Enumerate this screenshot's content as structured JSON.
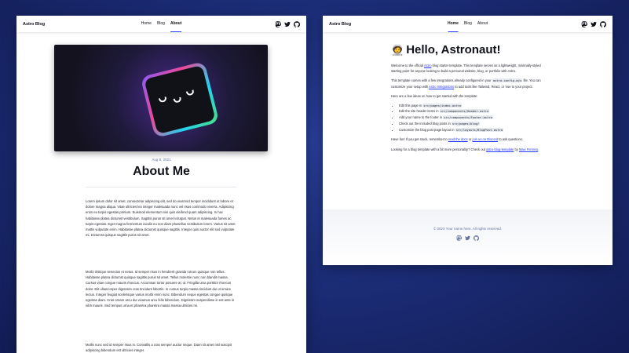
{
  "left": {
    "brand": "Astro Blog",
    "nav": [
      "Home",
      "Blog",
      "About"
    ],
    "active_nav": "About",
    "date": "Aug 8, 2021",
    "title": "About Me",
    "p1": "Lorem ipsum dolor sit amet, consectetur adipiscing elit, sed do eiusmod tempor incididunt ut labore et dolore magna aliqua. Vitae ultricies leo integer malesuada nunc vel risus commodo viverra. Adipiscing enim eu turpis egestas pretium. Euismod elementum nisi quis eleifend quam adipiscing. In hac habitasse platea dictumst vestibulum. Sagittis purus sit amet volutpat. Netus et malesuada fames ac turpis egestas. Eget magna fermentum iaculis eu non diam phasellus vestibulum lorem. Varius sit amet mattis vulputate enim. Habitasse platea dictumst quisque sagittis. Integer quis auctor elit sed vulputate mi. Dictumst quisque sagittis purus sit amet.",
    "p2": "Morbi tristique senectus et netus. Id semper risus in hendrerit gravida rutrum quisque non tellus. Habitasse platea dictumst quisque sagittis purus sit amet. Tellus molestie nunc non blandit massa. Cursus vitae congue mauris rhoncus. Accumsan tortor posuere ac ut. Fringilla urna porttitor rhoncus dolor. Elit ullamcorper dignissim cras tincidunt lobortis. In cursus turpis massa tincidunt dui ut ornare lectus. Integer feugiat scelerisque varius morbi enim nunc. Bibendum neque egestas congue quisque egestas diam. Cras ornare arcu dui vivamus arcu felis bibendum. Dignissim suspendisse in est ante in nibh mauris. Sed tempus urna et pharetra pharetra massa massa ultricies mi.",
    "p3": "Mollis nunc sed id semper risus in. Convallis a cras semper auctor neque. Diam sit amet nisl suscipit adipiscing bibendum est ultricies integer."
  },
  "right": {
    "brand": "Astro Blog",
    "nav": [
      "Home",
      "Blog",
      "About"
    ],
    "active_nav": "Home",
    "emoji": "🧑‍🚀",
    "heading": "Hello, Astronaut!",
    "intro_before": "Welcome to the official ",
    "intro_link": "Astro",
    "intro_after": " blog starter template. This template serves as a lightweight, minimally-styled starting point for anyone looking to build a personal website, blog, or portfolio with Astro.",
    "integrations_a": "This template comes with a few integrations already configured in your ",
    "integrations_code": "astro.config.mjs",
    "integrations_b": " file. You can customize your setup with ",
    "integrations_link": "Astro Integrations",
    "integrations_c": " to add tools like Tailwind, React, or Vue to your project.",
    "ideas_intro": "Here are a few ideas on how to get started with the template:",
    "ideas": [
      {
        "text": "Edit this page in ",
        "code": "src/pages/index.astro"
      },
      {
        "text": "Edit the site header items in ",
        "code": "src/components/Header.astro"
      },
      {
        "text": "Add your name to the footer in ",
        "code": "src/components/Footer.astro"
      },
      {
        "text": "Check out the included blog posts in ",
        "code": "src/pages/blog/"
      },
      {
        "text": "Customize the blog post page layout in ",
        "code": "src/layouts/BlogPost.astro"
      }
    ],
    "fun_a": "Have fun! If you get stuck, remember to ",
    "fun_link1": "read the docs",
    "fun_b": " or ",
    "fun_link2": "join us on Discord",
    "fun_c": " to ask questions.",
    "more_a": "Looking for a blog template with a bit more personality? Check out ",
    "more_link1": "astro-blog-template",
    "more_b": " by ",
    "more_link2": "Maxi Ferreira",
    "more_c": ".",
    "footer": "© 2023 Your name here. All rights reserved."
  },
  "colors": {
    "accent": "#2337ff",
    "text": "#0f1219",
    "muted": "#60739f",
    "background": "#1c2d78"
  },
  "icons": [
    "mastodon-icon",
    "twitter-icon",
    "github-icon"
  ]
}
